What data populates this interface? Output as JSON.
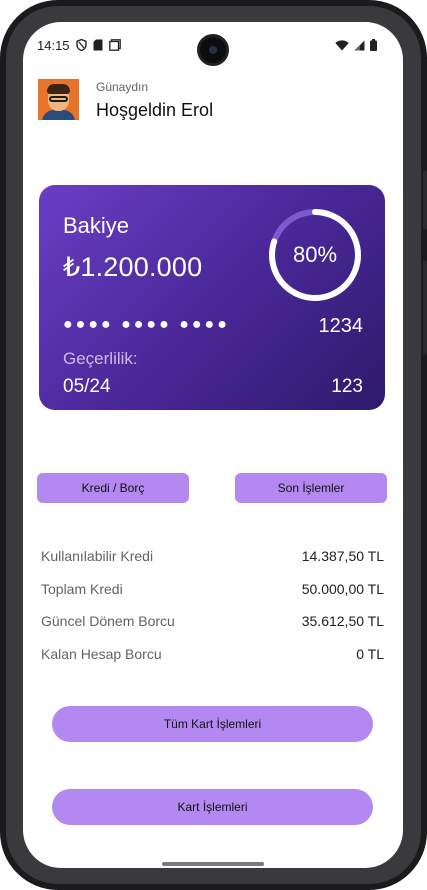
{
  "status_bar": {
    "time": "14:15",
    "left_icons": [
      "shield-icon",
      "sim-card-icon",
      "screen-icon"
    ],
    "right_icons": [
      "wifi-icon",
      "signal-icon",
      "battery-icon"
    ]
  },
  "header": {
    "greeting": "Günaydın",
    "welcome": "Hoşgeldin Erol"
  },
  "card": {
    "title": "Bakiye",
    "balance": "₺1.200.000",
    "progress_label": "80%",
    "progress_value": 0.8,
    "masked_number": "●●●● ●●●● ●●●●",
    "last_four": "1234",
    "validity_label": "Geçerlilik:",
    "validity": "05/24",
    "cvv": "123",
    "gradient_start": "#6a3fc4",
    "gradient_end": "#2d1a6b"
  },
  "tabs": {
    "credit_debt": "Kredi / Borç",
    "recent_transactions": "Son İşlemler"
  },
  "summary": [
    {
      "label": "Kullanılabilir Kredi",
      "value": "14.387,50 TL"
    },
    {
      "label": "Toplam Kredi",
      "value": "50.000,00 TL"
    },
    {
      "label": "Güncel Dönem Borcu",
      "value": "35.612,50 TL"
    },
    {
      "label": "Kalan Hesap Borcu",
      "value": "0 TL"
    }
  ],
  "actions": {
    "all_card_transactions": "Tüm Kart İşlemleri",
    "card_transactions": "Kart İşlemleri"
  },
  "colors": {
    "accent": "#b388f0"
  }
}
